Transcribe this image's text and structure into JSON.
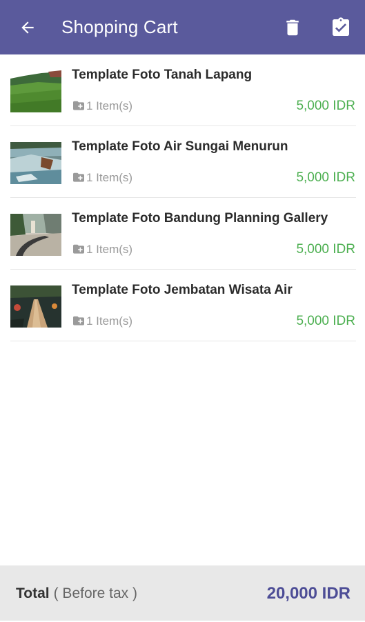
{
  "appbar": {
    "title": "Shopping Cart",
    "color": "#5a5a9c",
    "icons": [
      "arrow-back-icon",
      "trash-icon",
      "clipboard-check-icon"
    ]
  },
  "items": [
    {
      "name": "Template Foto Tanah Lapang",
      "quantity": "1 Item(s)",
      "price": "5,000 IDR",
      "thumbnail": "green-field-photo"
    },
    {
      "name": "Template Foto Air Sungai Menurun",
      "quantity": "1 Item(s)",
      "price": "5,000 IDR",
      "thumbnail": "river-rapids-photo"
    },
    {
      "name": "Template Foto Bandung Planning Gallery",
      "quantity": "1 Item(s)",
      "price": "5,000 IDR",
      "thumbnail": "park-pathway-photo"
    },
    {
      "name": "Template Foto Jembatan Wisata Air",
      "quantity": "1 Item(s)",
      "price": "5,000 IDR",
      "thumbnail": "wooden-bridge-photo"
    }
  ],
  "footer": {
    "total_label": "Total",
    "total_sublabel": "( Before tax )",
    "total_value": "20,000 IDR"
  },
  "colors": {
    "price": "#4caf50",
    "total": "#4d4d96",
    "footer_bg": "#e8e8e8"
  }
}
